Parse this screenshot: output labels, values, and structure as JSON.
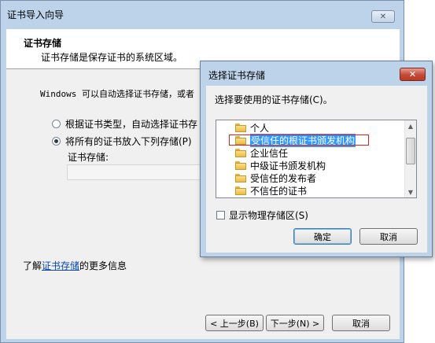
{
  "wizard": {
    "title": "证书导入向导",
    "close_icon": "close-icon",
    "header_title": "证书存储",
    "header_subtitle": "证书存储是保存证书的系统区域。",
    "body_text": "Windows 可以自动选择证书存储，或者",
    "radio_auto_label": "根据证书类型，自动选择证书存",
    "radio_manual_label": "将所有的证书放入下列存储(P)",
    "store_label": "证书存储:",
    "store_value": "",
    "more_info_prefix": "了解",
    "more_info_link": "证书存储",
    "more_info_suffix": "的更多信息",
    "back_button": "< 上一步(B)",
    "next_button": "下一步(N) >",
    "cancel_button": "取消"
  },
  "dialog": {
    "title": "选择证书存储",
    "close_icon": "close-icon",
    "prompt": "选择要使用的证书存储(C)。",
    "tree_items": [
      {
        "label": "个人",
        "icon": "folder-icon"
      },
      {
        "label": "受信任的根证书颁发机构",
        "icon": "folder-icon",
        "selected": true
      },
      {
        "label": "企业信任",
        "icon": "folder-icon"
      },
      {
        "label": "中级证书颁发机构",
        "icon": "folder-icon"
      },
      {
        "label": "受信任的发布者",
        "icon": "folder-icon"
      },
      {
        "label": "不信任的证书",
        "icon": "folder-icon"
      }
    ],
    "show_physical_label": "显示物理存储区(S)",
    "show_physical_checked": false,
    "ok_button": "确定",
    "cancel_button": "取消"
  },
  "colors": {
    "frame": "#bcd3ea",
    "selection": "#3399ff",
    "close_red": "#c44a36",
    "link": "#0645ad"
  }
}
